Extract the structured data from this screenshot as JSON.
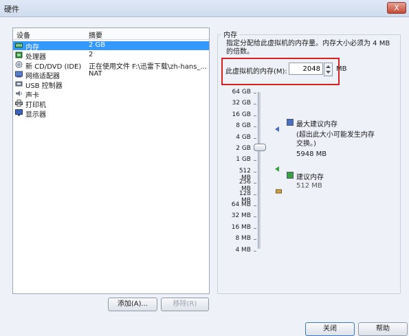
{
  "window": {
    "title": "硬件",
    "close_glyph": "X"
  },
  "device_list": {
    "headers": {
      "device": "设备",
      "summary": "摘要"
    },
    "rows": [
      {
        "name": "内存",
        "summary": "2 GB",
        "icon": "memory-icon",
        "selected": true
      },
      {
        "name": "处理器",
        "summary": "2",
        "icon": "processor-icon",
        "selected": false
      },
      {
        "name": "新 CD/DVD (IDE)",
        "summary": "正在使用文件 F:\\迅雷下载\\zh-hans_...",
        "icon": "cd-dvd-icon",
        "selected": false
      },
      {
        "name": "网络适配器",
        "summary": "NAT",
        "icon": "network-adapter-icon",
        "selected": false
      },
      {
        "name": "USB 控制器",
        "summary": "",
        "icon": "usb-icon",
        "selected": false
      },
      {
        "name": "声卡",
        "summary": "",
        "icon": "sound-card-icon",
        "selected": false
      },
      {
        "name": "打印机",
        "summary": "",
        "icon": "printer-icon",
        "selected": false
      },
      {
        "name": "显示器",
        "summary": "",
        "icon": "display-icon",
        "selected": false
      }
    ]
  },
  "buttons": {
    "add": "添加(A)...",
    "remove": "移除(R)",
    "close": "关闭",
    "help": "帮助"
  },
  "memory": {
    "group_title": "内存",
    "description": "指定分配给此虚拟机的内存量。内存大小必须为 4 MB 的倍数。",
    "field_label": "此虚拟机的内存(M):",
    "field_value": "2048",
    "unit": "MB",
    "scale_labels": [
      "64 GB",
      "32 GB",
      "16 GB",
      "8 GB",
      "4 GB",
      "2 GB",
      "1 GB",
      "512 MB",
      "256 MB",
      "128 MB",
      "64 MB",
      "32 MB",
      "16 MB",
      "8 MB",
      "4 MB"
    ],
    "slider_value": "2 GB",
    "legend": [
      {
        "title": "最大建议内存",
        "note": "(超出此大小可能发生内存交换。)",
        "value": "5948 MB",
        "color": "#4a6fc0"
      },
      {
        "title": "建议内存",
        "note": "",
        "value": "512 MB",
        "color": "#3aa040"
      }
    ]
  }
}
